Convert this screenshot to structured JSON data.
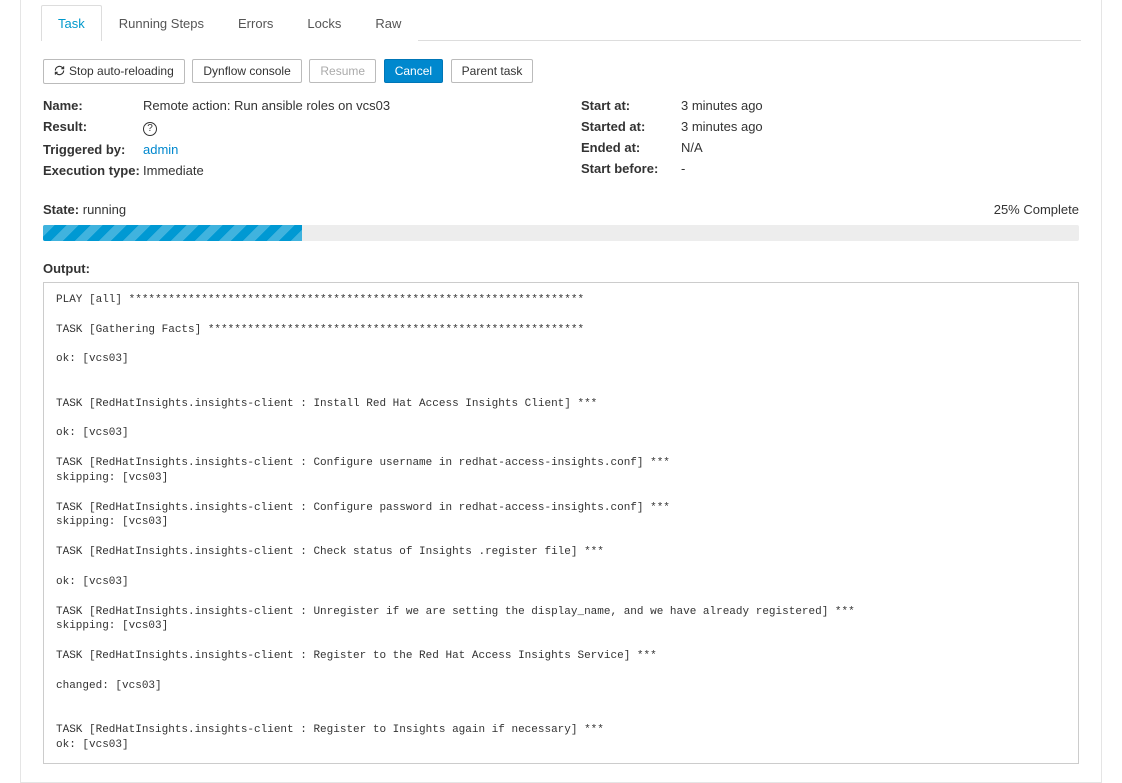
{
  "tabs": {
    "task": "Task",
    "running_steps": "Running Steps",
    "errors": "Errors",
    "locks": "Locks",
    "raw": "Raw"
  },
  "buttons": {
    "stop_reload": "Stop auto-reloading",
    "dynflow": "Dynflow console",
    "resume": "Resume",
    "cancel": "Cancel",
    "parent": "Parent task"
  },
  "labels": {
    "name": "Name:",
    "result": "Result:",
    "triggered_by": "Triggered by:",
    "execution_type": "Execution type:",
    "start_at": "Start at:",
    "started_at": "Started at:",
    "ended_at": "Ended at:",
    "start_before": "Start before:",
    "state": "State:",
    "output": "Output:"
  },
  "values": {
    "name": "Remote action: Run ansible roles on vcs03",
    "triggered_by": "admin",
    "execution_type": "Immediate",
    "start_at": "3 minutes ago",
    "started_at": "3 minutes ago",
    "ended_at": "N/A",
    "start_before": "-",
    "state": "running",
    "progress_text": "25% Complete",
    "progress_percent": 25
  },
  "output_text": "PLAY [all] *********************************************************************\n\nTASK [Gathering Facts] *********************************************************\n\nok: [vcs03]\n\n\nTASK [RedHatInsights.insights-client : Install Red Hat Access Insights Client] ***\n\nok: [vcs03]\n\nTASK [RedHatInsights.insights-client : Configure username in redhat-access-insights.conf] ***\nskipping: [vcs03]\n\nTASK [RedHatInsights.insights-client : Configure password in redhat-access-insights.conf] ***\nskipping: [vcs03]\n\nTASK [RedHatInsights.insights-client : Check status of Insights .register file] ***\n\nok: [vcs03]\n\nTASK [RedHatInsights.insights-client : Unregister if we are setting the display_name, and we have already registered] ***\nskipping: [vcs03]\n\nTASK [RedHatInsights.insights-client : Register to the Red Hat Access Insights Service] ***\n\nchanged: [vcs03]\n\n\nTASK [RedHatInsights.insights-client : Register to Insights again if necessary] ***\nok: [vcs03]"
}
